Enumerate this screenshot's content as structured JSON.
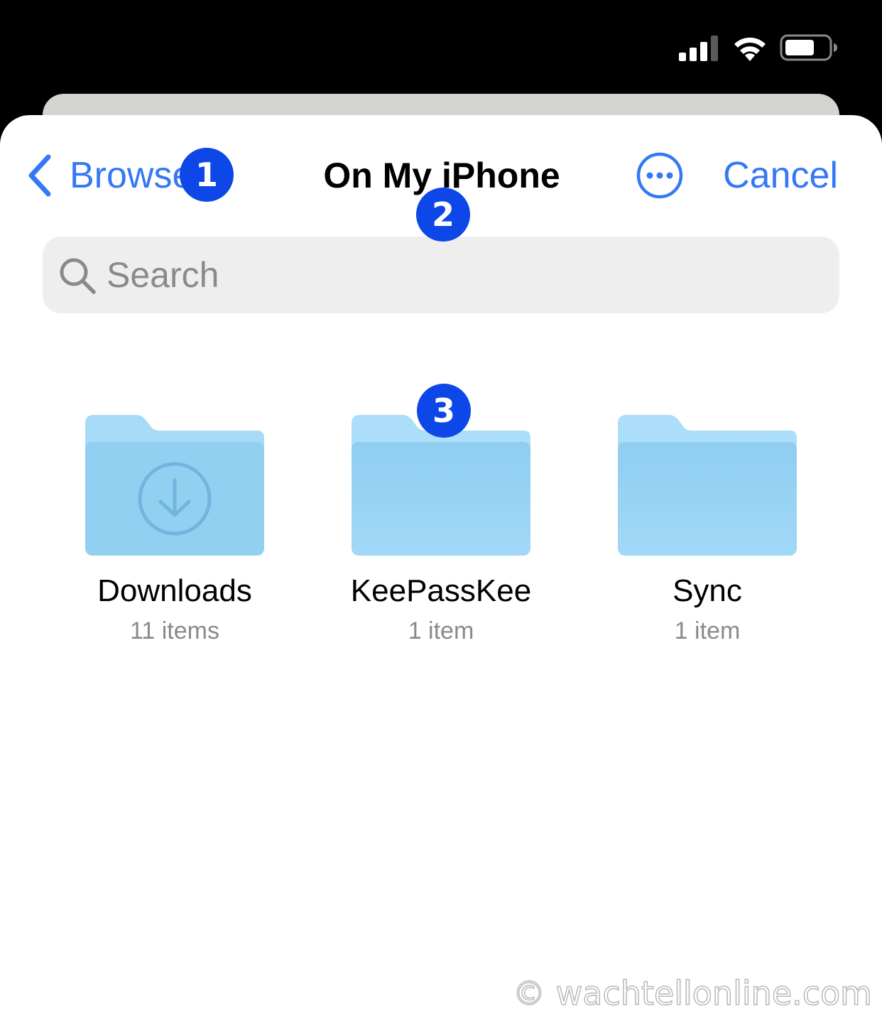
{
  "status_bar": {
    "signal_icon": "cellular-signal-icon",
    "wifi_icon": "wifi-icon",
    "battery_icon": "battery-icon"
  },
  "nav": {
    "back_label": "Browse",
    "back_icon": "chevron-left-icon",
    "title": "On My iPhone",
    "more_icon": "ellipsis-circle-icon",
    "cancel_label": "Cancel"
  },
  "search": {
    "placeholder": "Search",
    "value": "",
    "icon": "search-icon"
  },
  "folders": [
    {
      "name": "Downloads",
      "count": "11 items",
      "icon": "downloads-folder-icon"
    },
    {
      "name": "KeePassKee",
      "count": "1 item",
      "icon": "folder-icon"
    },
    {
      "name": "Sync",
      "count": "1 item",
      "icon": "folder-icon"
    }
  ],
  "annotations": [
    {
      "label": "1"
    },
    {
      "label": "2"
    },
    {
      "label": "3"
    }
  ],
  "watermark": "© wachtellonline.com",
  "colors": {
    "accent": "#3478f6",
    "badge": "#0d47e8",
    "folder_light": "#a8dbf7",
    "folder_dark": "#92d0f2"
  }
}
